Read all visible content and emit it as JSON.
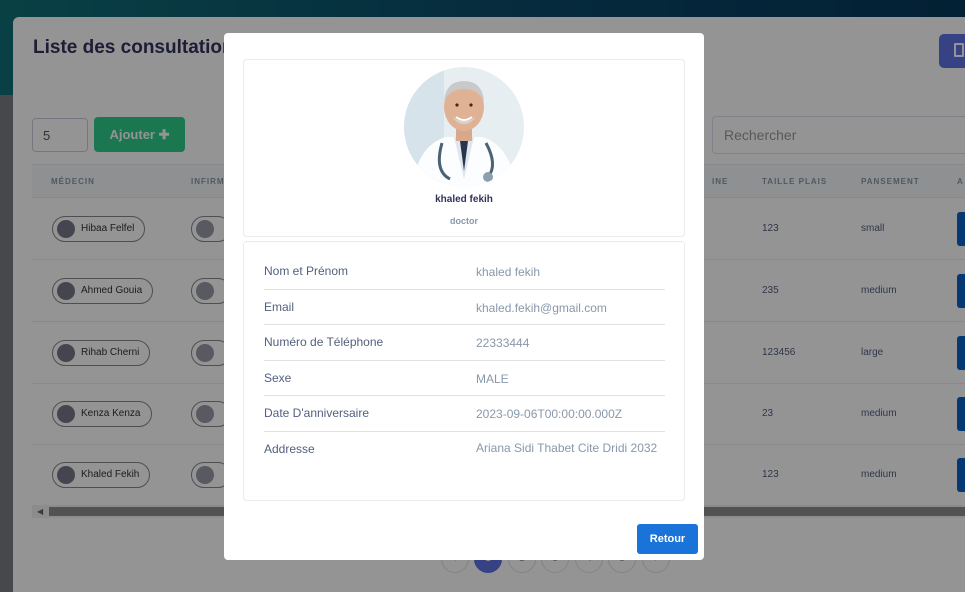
{
  "page": {
    "title": "Liste des consultations",
    "page_size": "5",
    "add_button": "Ajouter",
    "search_placeholder": "Rechercher",
    "columns": [
      "MÉDECIN",
      "INFIRM",
      "INE",
      "TAILLE PLAIS",
      "PANSEMENT",
      "A"
    ],
    "rows": [
      {
        "medecin": "Hibaa Felfel",
        "taille": "123",
        "pansement": "small"
      },
      {
        "medecin": "Ahmed Gouia",
        "taille": "235",
        "pansement": "medium"
      },
      {
        "medecin": "Rihab Cherni",
        "taille": "123456",
        "pansement": "large"
      },
      {
        "medecin": "Kenza Kenza",
        "taille": "23",
        "pansement": "medium"
      },
      {
        "medecin": "Khaled Fekih",
        "taille": "123",
        "pansement": "medium"
      }
    ],
    "pagination": {
      "prev": "‹",
      "next": "›",
      "pages": [
        "1",
        "2",
        "3",
        "4",
        "5"
      ],
      "active": "1"
    }
  },
  "modal": {
    "name": "khaled fekih",
    "role": "doctor",
    "details": [
      {
        "label": "Nom et Prénom",
        "value": "khaled fekih"
      },
      {
        "label": "Email",
        "value": "khaled.fekih@gmail.com"
      },
      {
        "label": "Numéro de Téléphone",
        "value": "22333444"
      },
      {
        "label": "Sexe",
        "value": "MALE"
      },
      {
        "label": "Date D'anniversaire",
        "value": "2023-09-06T00:00:00.000Z"
      },
      {
        "label": "Addresse",
        "value": "Ariana Sidi Thabet Cite Dridi 2032"
      }
    ],
    "back_button": "Retour"
  },
  "colors": {
    "primary": "#5e72e4",
    "success": "#2dce89",
    "action": "#1a73d9"
  }
}
